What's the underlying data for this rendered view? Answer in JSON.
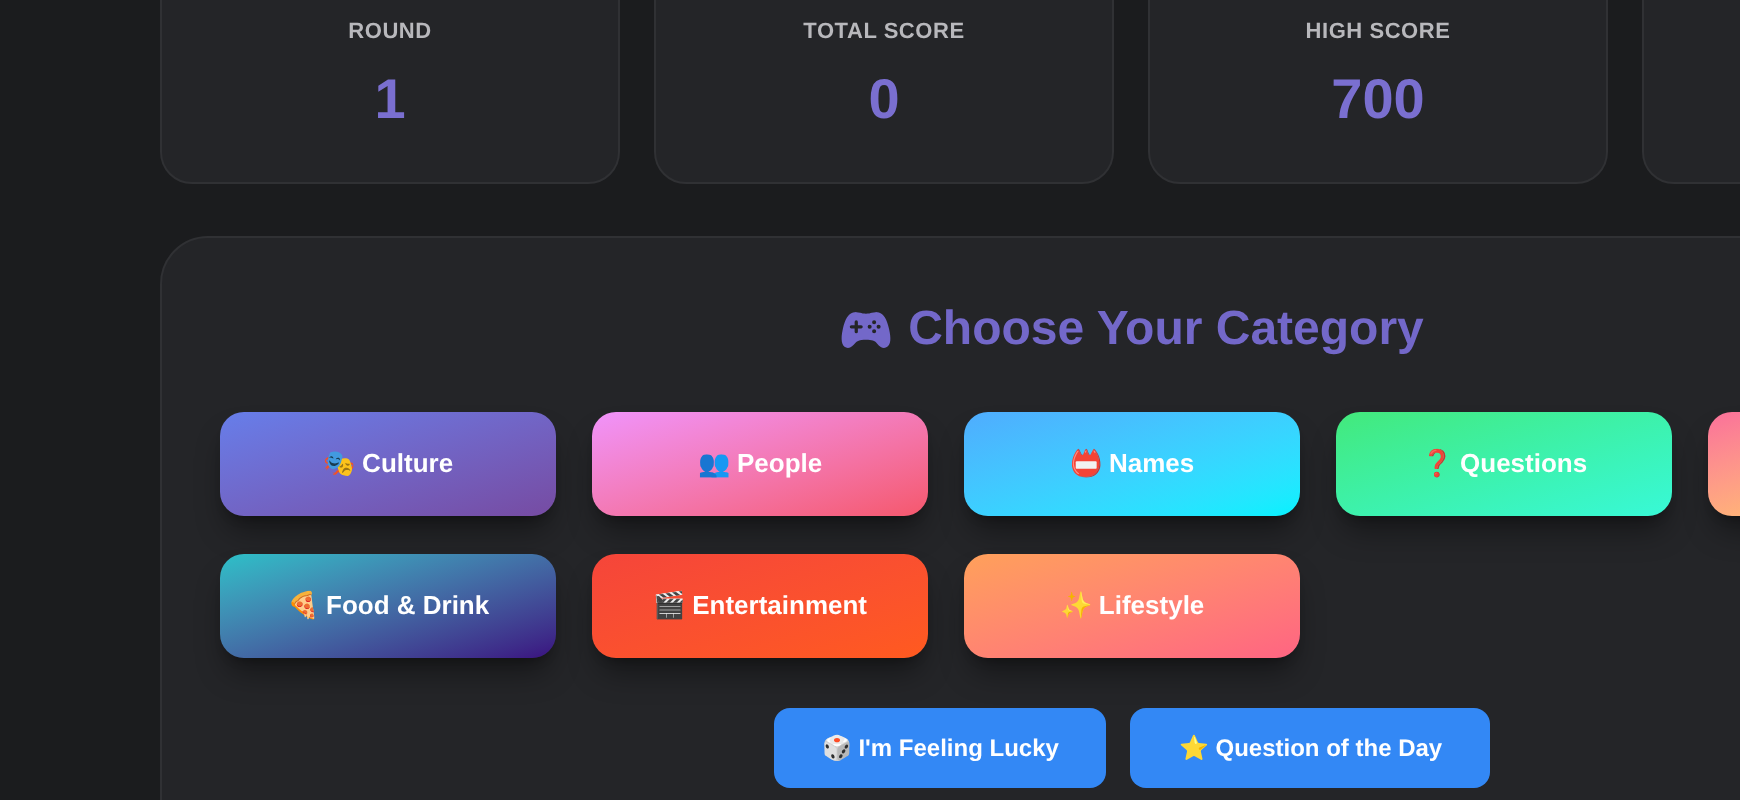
{
  "stats": [
    {
      "kind": "card",
      "label": "ROUND",
      "value": "1"
    },
    {
      "kind": "card",
      "label": "TOTAL SCORE",
      "value": "0"
    },
    {
      "kind": "card",
      "label": "HIGH SCORE",
      "value": "700"
    },
    {
      "kind": "clipped"
    }
  ],
  "panel": {
    "title": "Choose Your Category",
    "categories": [
      {
        "kind": "button",
        "emoji": "🎭",
        "label": "Culture"
      },
      {
        "kind": "button",
        "emoji": "👥",
        "label": "People"
      },
      {
        "kind": "button",
        "emoji": "📛",
        "label": "Names"
      },
      {
        "kind": "button",
        "emoji": "❓",
        "label": "Questions"
      },
      {
        "kind": "clipped"
      },
      {
        "kind": "button",
        "emoji": "🍕",
        "label": "Food & Drink"
      },
      {
        "kind": "button",
        "emoji": "🎬",
        "label": "Entertainment"
      },
      {
        "kind": "button",
        "emoji": "✨",
        "label": "Lifestyle"
      }
    ],
    "actions": [
      {
        "emoji": "🎲",
        "label": "I'm Feeling Lucky"
      },
      {
        "emoji": "⭐",
        "label": "Question of the Day"
      }
    ]
  }
}
